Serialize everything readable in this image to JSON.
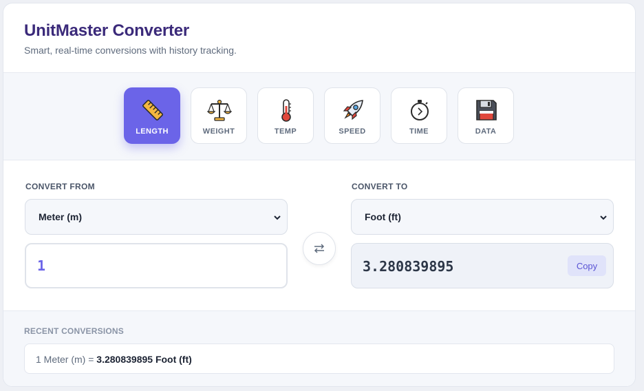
{
  "app": {
    "title": "UnitMaster Converter",
    "subtitle": "Smart, real-time conversions with history tracking."
  },
  "categories": [
    {
      "label": "LENGTH",
      "icon": "ruler-icon",
      "active": true
    },
    {
      "label": "WEIGHT",
      "icon": "balance-scale-icon",
      "active": false
    },
    {
      "label": "TEMP",
      "icon": "thermometer-icon",
      "active": false
    },
    {
      "label": "SPEED",
      "icon": "rocket-icon",
      "active": false
    },
    {
      "label": "TIME",
      "icon": "stopwatch-icon",
      "active": false
    },
    {
      "label": "DATA",
      "icon": "floppy-disk-icon",
      "active": false
    }
  ],
  "from": {
    "label": "CONVERT FROM",
    "unit": "Meter (m)",
    "value": "1"
  },
  "to": {
    "label": "CONVERT TO",
    "unit": "Foot (ft)",
    "value": "3.280839895",
    "copy_label": "Copy"
  },
  "history": {
    "label": "RECENT CONVERSIONS",
    "items": [
      {
        "input": "1 Meter (m) =",
        "output": "3.280839895 Foot (ft)"
      }
    ]
  },
  "colors": {
    "accent": "#6b64e8",
    "title": "#3b2a7a"
  }
}
